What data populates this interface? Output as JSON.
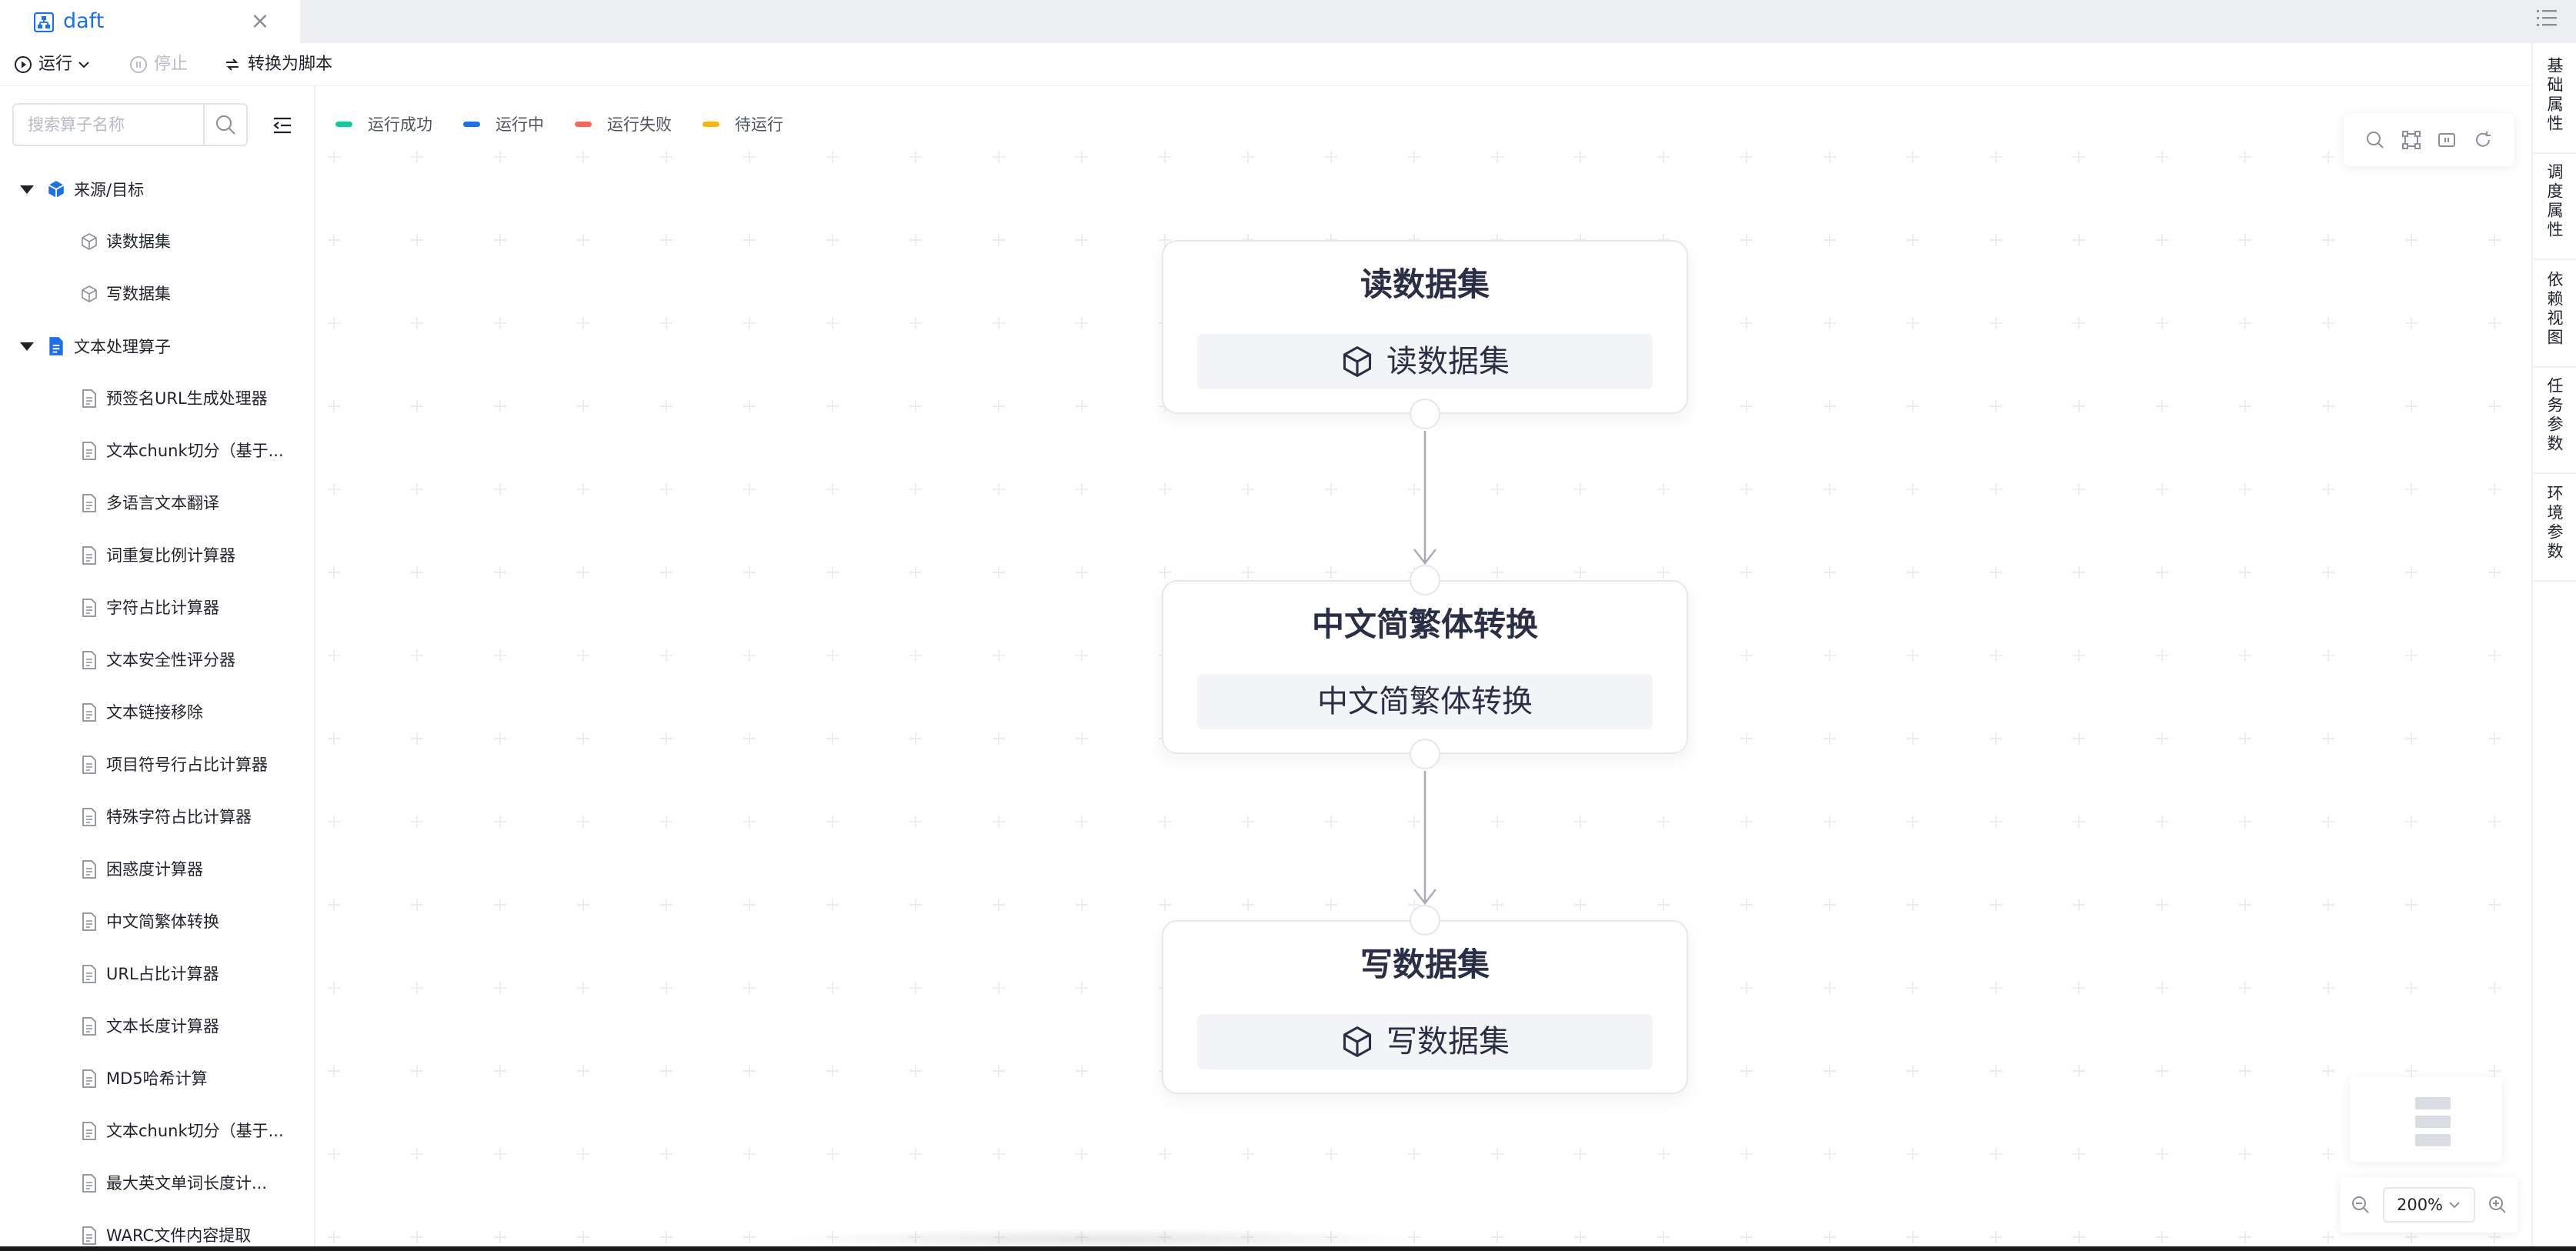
{
  "tab": {
    "title": "daft",
    "close": "×"
  },
  "toolbar": {
    "run": "运行",
    "stop": "停止",
    "to_script": "转换为脚本"
  },
  "search": {
    "placeholder": "搜索算子名称"
  },
  "tree": {
    "groups": [
      {
        "label": "来源/目标",
        "items": [
          "读数据集",
          "写数据集"
        ]
      },
      {
        "label": "文本处理算子",
        "items": [
          "预签名URL生成处理器",
          "文本chunk切分（基于...",
          "多语言文本翻译",
          "词重复比例计算器",
          "字符占比计算器",
          "文本安全性评分器",
          "文本链接移除",
          "项目符号行占比计算器",
          "特殊字符占比计算器",
          "困惑度计算器",
          "中文简繁体转换",
          "URL占比计算器",
          "文本长度计算器",
          "MD5哈希计算",
          "文本chunk切分（基于...",
          "最大英文单词长度计...",
          "WARC文件内容提取"
        ]
      }
    ]
  },
  "legend": [
    {
      "label": "运行成功",
      "color": "#19c79a"
    },
    {
      "label": "运行中",
      "color": "#1f6fe5"
    },
    {
      "label": "运行失败",
      "color": "#f06a5a"
    },
    {
      "label": "待运行",
      "color": "#f2b51b"
    }
  ],
  "nodes": [
    {
      "title": "读数据集",
      "body": "读数据集",
      "icon": "cube-icon"
    },
    {
      "title": "中文简繁体转换",
      "body": "中文简繁体转换",
      "icon": ""
    },
    {
      "title": "写数据集",
      "body": "写数据集",
      "icon": "cube-icon"
    }
  ],
  "zoom": {
    "level": "200%"
  },
  "right_tabs": [
    "基础属性",
    "调度属性",
    "依赖视图",
    "任务参数",
    "环境参数"
  ],
  "colors": {
    "accent": "#1f6fe5",
    "node_text": "#2b2f45",
    "edge": "#a9adb8"
  }
}
